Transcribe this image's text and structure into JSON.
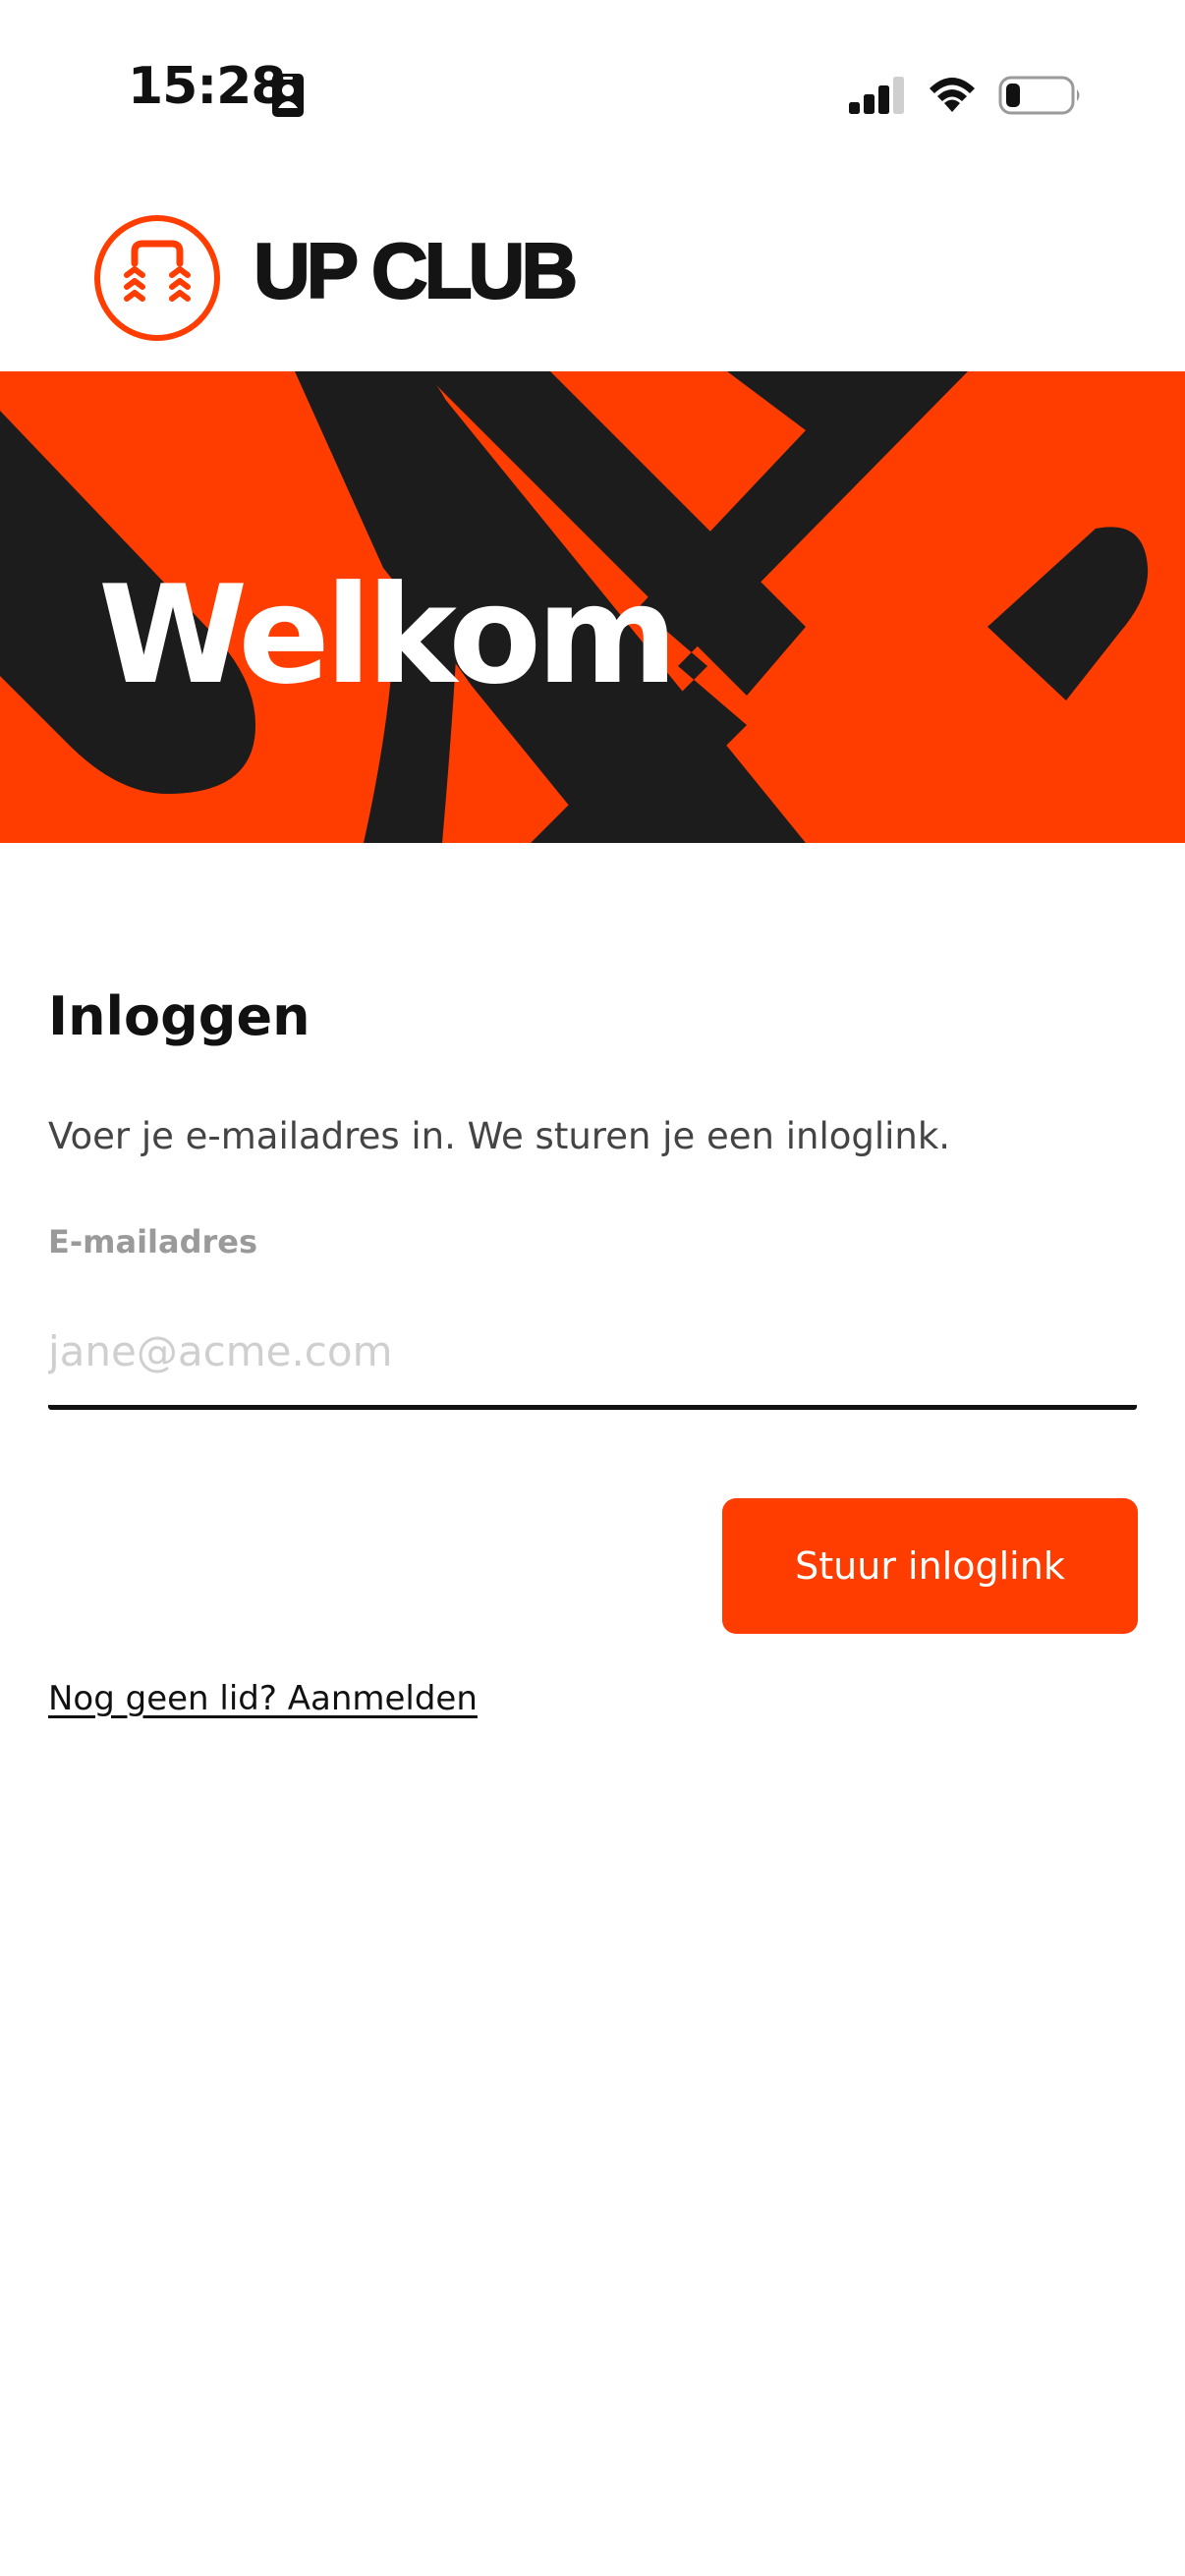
{
  "status_bar": {
    "time": "15:28",
    "icons": [
      "contact-card-icon",
      "cellular-signal-icon",
      "wifi-icon",
      "battery-low-icon"
    ]
  },
  "header": {
    "brand_name": "UP CLUB",
    "logo_icon": "up-club-logo-icon"
  },
  "hero": {
    "title": "Welkom"
  },
  "login": {
    "heading": "Inloggen",
    "description": "Voer je e-mailadres in. We sturen je een inloglink.",
    "email_label": "E-mailadres",
    "email_value": "",
    "email_placeholder": "jane@acme.com",
    "submit_label": "Stuur inloglink",
    "signup_link": "Nog geen lid? Aanmelden"
  },
  "colors": {
    "brand_orange": "#ff3d00",
    "dark": "#1c1c1c",
    "text": "#111111",
    "muted_label": "#9a9a9a",
    "placeholder": "#cfcfcf"
  }
}
